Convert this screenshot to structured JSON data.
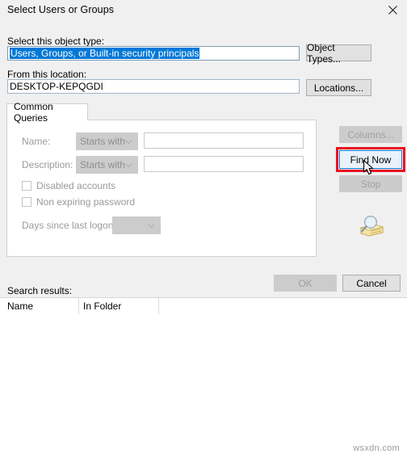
{
  "window": {
    "title": "Select Users or Groups",
    "close_icon": "close-icon"
  },
  "object_type": {
    "label": "Select this object type:",
    "value": "Users, Groups, or Built-in security principals",
    "button_label": "Object Types..."
  },
  "location": {
    "label": "From this location:",
    "value": "DESKTOP-KEPQGDI",
    "button_label": "Locations..."
  },
  "tab": {
    "label": "Common Queries"
  },
  "queries": {
    "name": {
      "label": "Name:",
      "operator": "Starts with",
      "value": "",
      "placeholder": ""
    },
    "description": {
      "label": "Description:",
      "operator": "Starts with",
      "value": "",
      "placeholder": ""
    },
    "disabled_accounts": {
      "label": "Disabled accounts",
      "checked": false
    },
    "non_expiring_password": {
      "label": "Non expiring password",
      "checked": false
    },
    "days_since_last_logon": {
      "label": "Days since last logon:",
      "value": ""
    }
  },
  "side_buttons": {
    "columns": "Columns...",
    "find_now": "Find Now",
    "stop": "Stop",
    "search_icon": "search-magnifier-icon"
  },
  "dialog_buttons": {
    "ok": "OK",
    "cancel": "Cancel"
  },
  "results": {
    "label": "Search results:",
    "columns": [
      "Name",
      "In Folder"
    ],
    "rows": []
  },
  "annotation": {
    "highlight_color": "#e81123",
    "target": "find-now-button"
  },
  "watermark": {
    "text": "wsxdn.com"
  }
}
